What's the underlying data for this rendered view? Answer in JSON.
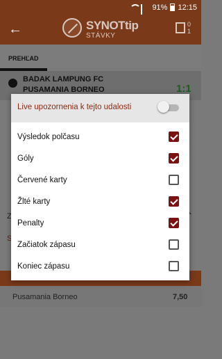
{
  "status": {
    "battery": "91%",
    "time": "12:15"
  },
  "toolbar": {
    "logo_text": "SYNOTtip",
    "logo_sub": "STÁVKY",
    "ticket_count_top": "0",
    "ticket_count_bottom": "1"
  },
  "tabs": {
    "prehlad": "PREHĽAD"
  },
  "match": {
    "home": "BADAK LAMPUNG FC",
    "away": "PUSAMANIA BORNEO",
    "score": "1:1"
  },
  "background_row": {
    "name": "Pusamania Borneo",
    "odds": "7,50"
  },
  "background_side": {
    "z": "Z",
    "s": "S"
  },
  "dialog": {
    "title": "Live upozornenia k tejto udalosti",
    "toggle_on": false,
    "options": [
      {
        "label": "Výsledok polčasu",
        "checked": true
      },
      {
        "label": "Góly",
        "checked": true
      },
      {
        "label": "Červené karty",
        "checked": false
      },
      {
        "label": "Žlté karty",
        "checked": true
      },
      {
        "label": "Penalty",
        "checked": true
      },
      {
        "label": "Začiatok zápasu",
        "checked": false
      },
      {
        "label": "Koniec zápasu",
        "checked": false
      }
    ]
  },
  "colors": {
    "accent": "#7a1212",
    "title_color": "#8a2b14",
    "toolbar": "#e8541f"
  }
}
